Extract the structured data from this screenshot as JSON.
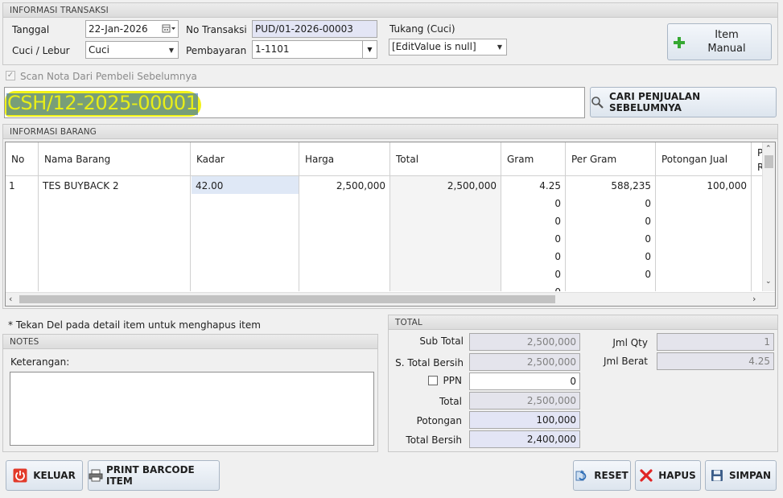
{
  "transaksi": {
    "title": "INFORMASI TRANSAKSI",
    "tanggal_label": "Tanggal",
    "tanggal_value": "22-Jan-2026",
    "cuci_label": "Cuci / Lebur",
    "cuci_value": "Cuci",
    "no_transaksi_label": "No Transaksi",
    "no_transaksi_value": "PUD/01-2026-00003",
    "pembayaran_label": "Pembayaran",
    "pembayaran_value": "1-1101",
    "tukang_label": "Tukang (Cuci)",
    "tukang_value": "[EditValue is null]",
    "item_manual_line1": "Item",
    "item_manual_line2": "Manual"
  },
  "scan": {
    "checkbox_label": "Scan Nota Dari Pembeli Sebelumnya",
    "checked": true,
    "value": "CSH/12-2025-00001",
    "highlight_color": "#f2f21a",
    "search_button": "CARI PENJUALAN SEBELUMNYA"
  },
  "barang": {
    "title": "INFORMASI BARANG",
    "headers": [
      "No",
      "Nama Barang",
      "Kadar",
      "Harga",
      "Total",
      "Gram",
      "Per Gram",
      "Potongan Jual",
      "P",
      "R"
    ],
    "row1": {
      "no": "1",
      "nama": "TES BUYBACK 2",
      "kadar": "42.00",
      "harga": "2,500,000",
      "total": "2,500,000",
      "gram": "4.25",
      "per_gram": "588,235",
      "potongan": "100,000"
    },
    "extra_gram": [
      "0",
      "0",
      "0",
      "0",
      "0",
      "0"
    ],
    "extra_per_gram": [
      "0",
      "0",
      "0",
      "0",
      "0"
    ]
  },
  "hint": "* Tekan Del pada detail item untuk menghapus item",
  "notes": {
    "title": "NOTES",
    "keterangan_label": "Keterangan:",
    "keterangan_value": ""
  },
  "total": {
    "title": "TOTAL",
    "sub_total_label": "Sub Total",
    "sub_total_value": "2,500,000",
    "s_total_bersih_label": "S. Total Bersih",
    "s_total_bersih_value": "2,500,000",
    "ppn_label": "PPN",
    "ppn_value": "0",
    "total_label": "Total",
    "total_value": "2,500,000",
    "potongan_label": "Potongan",
    "potongan_value": "100,000",
    "total_bersih_label": "Total Bersih",
    "total_bersih_value": "2,400,000",
    "jml_qty_label": "Jml Qty",
    "jml_qty_value": "1",
    "jml_berat_label": "Jml Berat",
    "jml_berat_value": "4.25"
  },
  "buttons": {
    "keluar": "KELUAR",
    "print": "PRINT BARCODE ITEM",
    "reset": "RESET",
    "hapus": "HAPUS",
    "simpan": "SIMPAN"
  },
  "icons": {
    "calendar": "calendar-icon",
    "plus": "plus-icon",
    "search": "search-icon",
    "power": "power-icon",
    "printer": "printer-icon",
    "reset": "refresh-icon",
    "delete": "x-icon",
    "save": "floppy-icon"
  },
  "colors": {
    "plus_green": "#35a832",
    "power_red": "#e23a2a",
    "delete_red": "#e02424",
    "save_blue": "#3e5f8a"
  }
}
